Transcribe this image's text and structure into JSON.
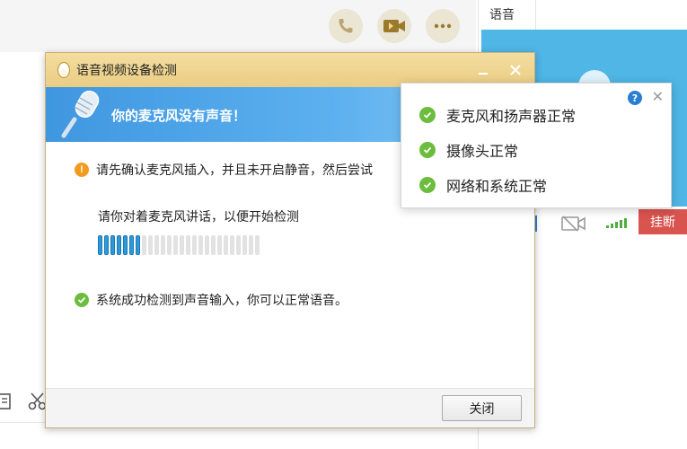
{
  "chat": {
    "voice_tab_label": "语音",
    "hangup_label": "挂断"
  },
  "dialog": {
    "title": "语音视频设备检测",
    "banner_text": "你的麦克风没有声音！",
    "warning_text": "请先确认麦克风插入，并且未开启静音，然后尝试",
    "instruction_text": "请你对着麦克风讲话，以便开始检测",
    "meter": {
      "active_segments": 7,
      "total_segments": 26
    },
    "success_text": "系统成功检测到声音输入，你可以正常语音。",
    "close_button": "关闭",
    "minimize_icon": "minimize-icon",
    "close_icon": "close-icon"
  },
  "status_popup": {
    "items": [
      {
        "label": "麦克风和扬声器正常",
        "icon": "check-icon"
      },
      {
        "label": "摄像头正常",
        "icon": "check-icon"
      },
      {
        "label": "网络和系统正常",
        "icon": "check-icon"
      }
    ]
  },
  "colors": {
    "accent_blue": "#2d9ad8",
    "ok_green": "#6cbd3d",
    "warn_orange": "#f29b1e",
    "hangup_red": "#d9534f",
    "title_gold": "#eacd84"
  }
}
